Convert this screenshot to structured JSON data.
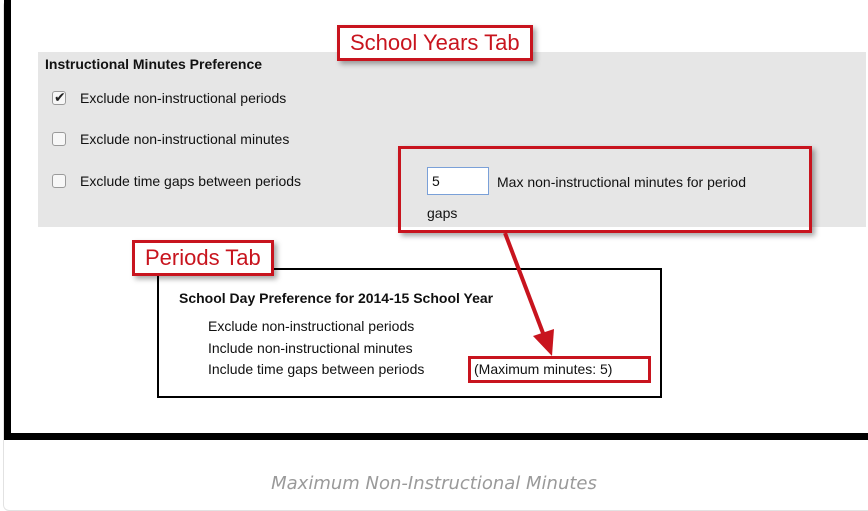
{
  "school_years_section": {
    "callout_label": "School Years Tab",
    "title": "Instructional Minutes Preference",
    "options": [
      {
        "label": "Exclude non-instructional periods",
        "checked": true
      },
      {
        "label": "Exclude non-instructional minutes",
        "checked": false
      },
      {
        "label": "Exclude time gaps between periods",
        "checked": false
      }
    ],
    "max_minutes": {
      "value": "5",
      "label_line1": "Max non-instructional minutes for period",
      "label_line2": "gaps"
    }
  },
  "periods_section": {
    "callout_label": "Periods Tab",
    "title": "School Day Preference for 2014-15 School Year",
    "lines": [
      "Exclude non-instructional periods",
      "Include non-instructional minutes",
      "Include time gaps between periods"
    ],
    "max_minutes_note": "(Maximum minutes: 5)"
  },
  "caption": "Maximum Non-Instructional Minutes",
  "colors": {
    "callout_red": "#c8141e",
    "panel_gray": "#e6e6e6",
    "caption_gray": "#9a9a9a"
  },
  "icons": {
    "checkbox_checked": "check-mark-icon"
  }
}
